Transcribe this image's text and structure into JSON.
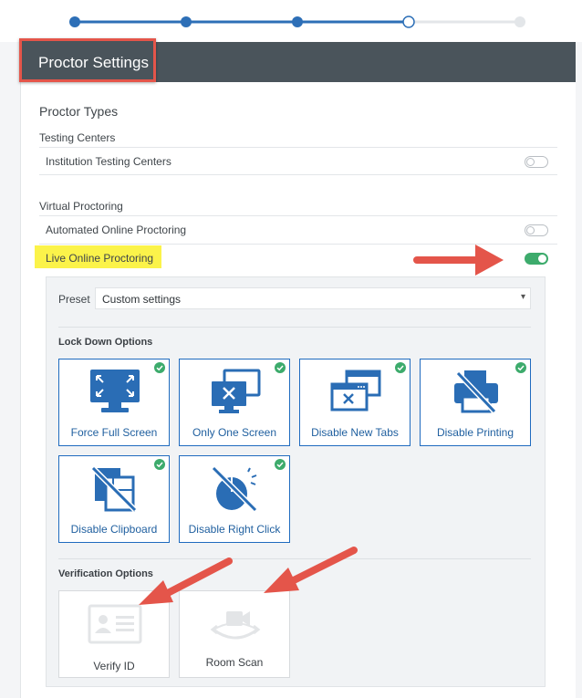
{
  "header": {
    "title": "Proctor Settings"
  },
  "stepper": {
    "total_steps": 5,
    "completed_steps": 3,
    "current_step": 4
  },
  "proctor_types": {
    "title": "Proctor Types",
    "testing_centers": {
      "label": "Testing Centers",
      "items": [
        {
          "label": "Institution Testing Centers",
          "enabled": false
        }
      ]
    },
    "virtual_proctoring": {
      "label": "Virtual Proctoring",
      "items": [
        {
          "label": "Automated Online Proctoring",
          "enabled": false
        },
        {
          "label": "Live Online Proctoring",
          "enabled": true
        }
      ]
    }
  },
  "preset": {
    "label": "Preset",
    "value": "Custom settings"
  },
  "lock_down": {
    "title": "Lock Down Options",
    "options": [
      {
        "label": "Force Full Screen",
        "icon": "fullscreen-monitor-icon",
        "checked": true
      },
      {
        "label": "Only One Screen",
        "icon": "single-screen-icon",
        "checked": true
      },
      {
        "label": "Disable New Tabs",
        "icon": "new-tabs-icon",
        "checked": true
      },
      {
        "label": "Disable Printing",
        "icon": "printer-disabled-icon",
        "checked": true
      },
      {
        "label": "Disable Clipboard",
        "icon": "clipboard-disabled-icon",
        "checked": true
      },
      {
        "label": "Disable Right Click",
        "icon": "mouse-disabled-icon",
        "checked": true
      }
    ]
  },
  "verification": {
    "title": "Verification Options",
    "options": [
      {
        "label": "Verify ID",
        "icon": "id-card-icon",
        "checked": false
      },
      {
        "label": "Room Scan",
        "icon": "room-scan-camera-icon",
        "checked": false
      }
    ]
  },
  "colors": {
    "accent_blue": "#1f6bbf",
    "header_bg": "#4a545b",
    "toggle_on": "#3dab6c",
    "highlight_yellow": "#fbf34a",
    "annotation_red": "#e4554a"
  }
}
